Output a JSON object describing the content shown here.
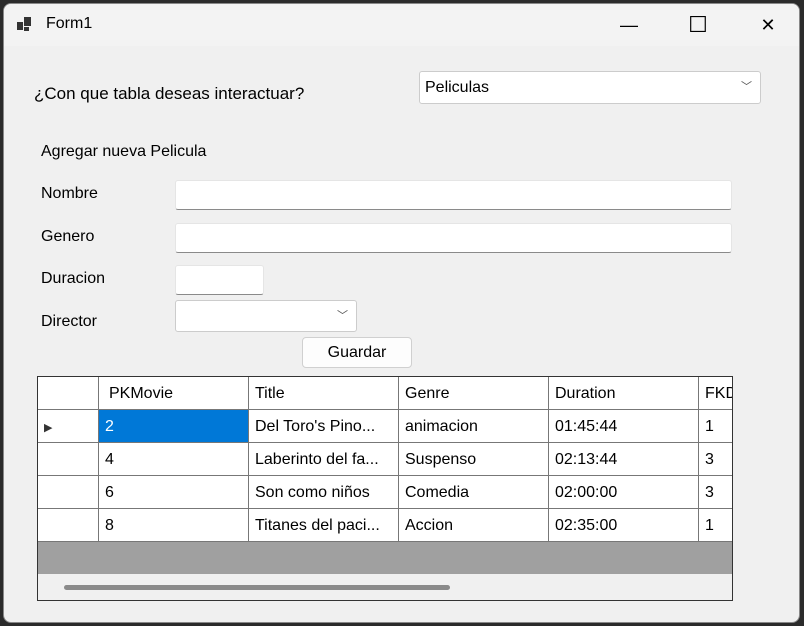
{
  "window": {
    "title": "Form1",
    "minimize": "—",
    "maximize": "☐",
    "close": "✕"
  },
  "table_selector": {
    "label": "¿Con que tabla deseas interactuar?",
    "value": "Peliculas"
  },
  "form": {
    "heading": "Agregar nueva Pelicula",
    "nombre_label": "Nombre",
    "nombre_value": "",
    "genero_label": "Genero",
    "genero_value": "",
    "duracion_label": "Duracion",
    "duracion_value": "",
    "director_label": "Director",
    "director_value": "",
    "save_label": "Guardar"
  },
  "grid": {
    "columns": [
      "PKMovie",
      "Title",
      "Genre",
      "Duration",
      "FKDirector"
    ],
    "rows": [
      [
        "2",
        "Del Toro's Pino...",
        "animacion",
        "01:45:44",
        "1"
      ],
      [
        "4",
        "Laberinto del fa...",
        "Suspenso",
        "02:13:44",
        "3"
      ],
      [
        "6",
        "Son como niños",
        "Comedia",
        "02:00:00",
        "3"
      ],
      [
        "8",
        "Titanes del paci...",
        "Accion",
        "02:35:00",
        "1"
      ]
    ],
    "selected_row": 0,
    "selected_color": "#0078d7"
  }
}
